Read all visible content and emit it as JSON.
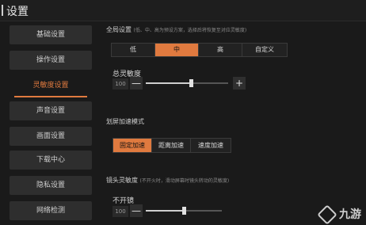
{
  "header": {
    "title": "设置"
  },
  "sidebar": {
    "items": [
      {
        "label": "基础设置",
        "active": false
      },
      {
        "label": "操作设置",
        "active": false
      },
      {
        "label": "灵敏度设置",
        "active": true
      },
      {
        "label": "声音设置",
        "active": false
      },
      {
        "label": "画面设置",
        "active": false
      },
      {
        "label": "下载中心",
        "active": false
      },
      {
        "label": "隐私设置",
        "active": false
      },
      {
        "label": "网络检测",
        "active": false
      }
    ]
  },
  "global": {
    "title": "全局设置",
    "hint": "(低、中、高为预设方案，选择后将恢复至对应灵敏度)",
    "tabs": [
      "低",
      "中",
      "高",
      "自定义"
    ],
    "selected": "中"
  },
  "overall": {
    "label": "总灵敏度",
    "value": "100",
    "minus": "—",
    "plus": "+",
    "level": 0.55
  },
  "scroll_accel": {
    "title": "划屏加速模式",
    "tabs": [
      "固定加速",
      "距离加速",
      "速度加速"
    ],
    "selected": "固定加速"
  },
  "lens": {
    "title": "镜头灵敏度",
    "hint": "(不开火时，滑动屏幕时镜头转动的灵敏度)",
    "sub_label": "不开镜",
    "value": "100",
    "minus": "—",
    "level": 0.5
  },
  "watermark": {
    "text": "九游"
  }
}
